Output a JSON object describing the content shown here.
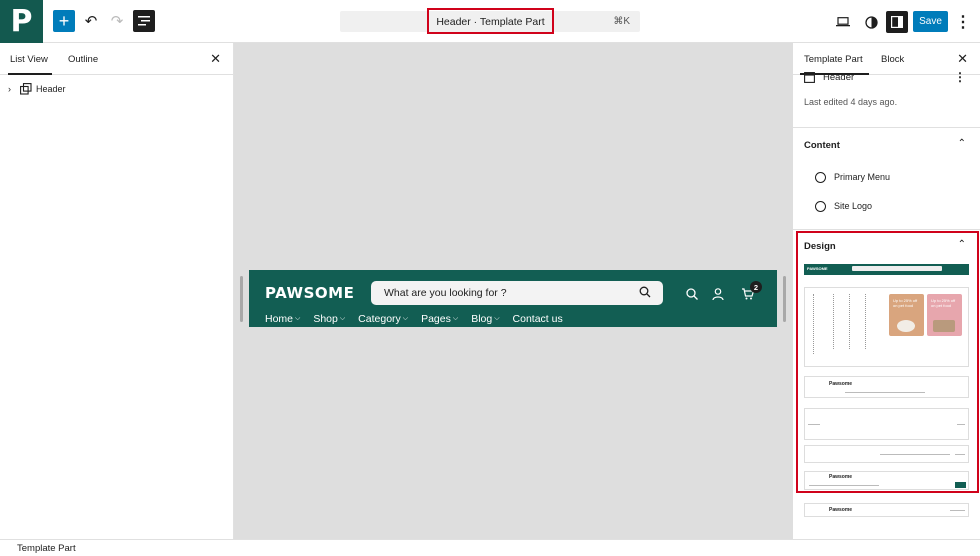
{
  "app": {
    "logo_letter": "P",
    "brand_color": "#13594f"
  },
  "toolbar": {
    "command_title": "Header · Template Part",
    "command_shortcut": "⌘K",
    "save_label": "Save"
  },
  "left_panel": {
    "tabs": [
      "List View",
      "Outline"
    ],
    "tree": [
      {
        "label": "Header"
      }
    ]
  },
  "canvas": {
    "brand": "PAWSOME",
    "search_placeholder": "What are you looking for ?",
    "cart_count": "2",
    "nav": [
      "Home",
      "Shop",
      "Category",
      "Pages",
      "Blog",
      "Contact us"
    ],
    "header_color": "#125e53"
  },
  "right_panel": {
    "tabs": [
      "Template Part",
      "Block"
    ],
    "part_name": "Header",
    "last_edited": "Last edited 4 days ago.",
    "content_title": "Content",
    "content_items": [
      {
        "label": "Primary Menu",
        "icon": "navigation-icon"
      },
      {
        "label": "Site Logo",
        "icon": "site-logo-icon"
      }
    ],
    "design_title": "Design",
    "thumbnails": [
      {
        "brand": "PAWSOME"
      },
      {
        "promo_1": "Up to 25% off on pet food",
        "promo_2": "Up to 25% off on pet food"
      },
      {
        "brand": "Pawsome"
      },
      {
        "brand": "Pawsome"
      },
      {
        "brand": ""
      },
      {
        "brand": "Pawsome"
      },
      {
        "brand": "Pawsome"
      }
    ]
  },
  "status": {
    "label": "Template Part"
  },
  "colors": {
    "accent": "#007cba",
    "highlight": "#d0021b",
    "canvas_bg": "#dedede"
  }
}
